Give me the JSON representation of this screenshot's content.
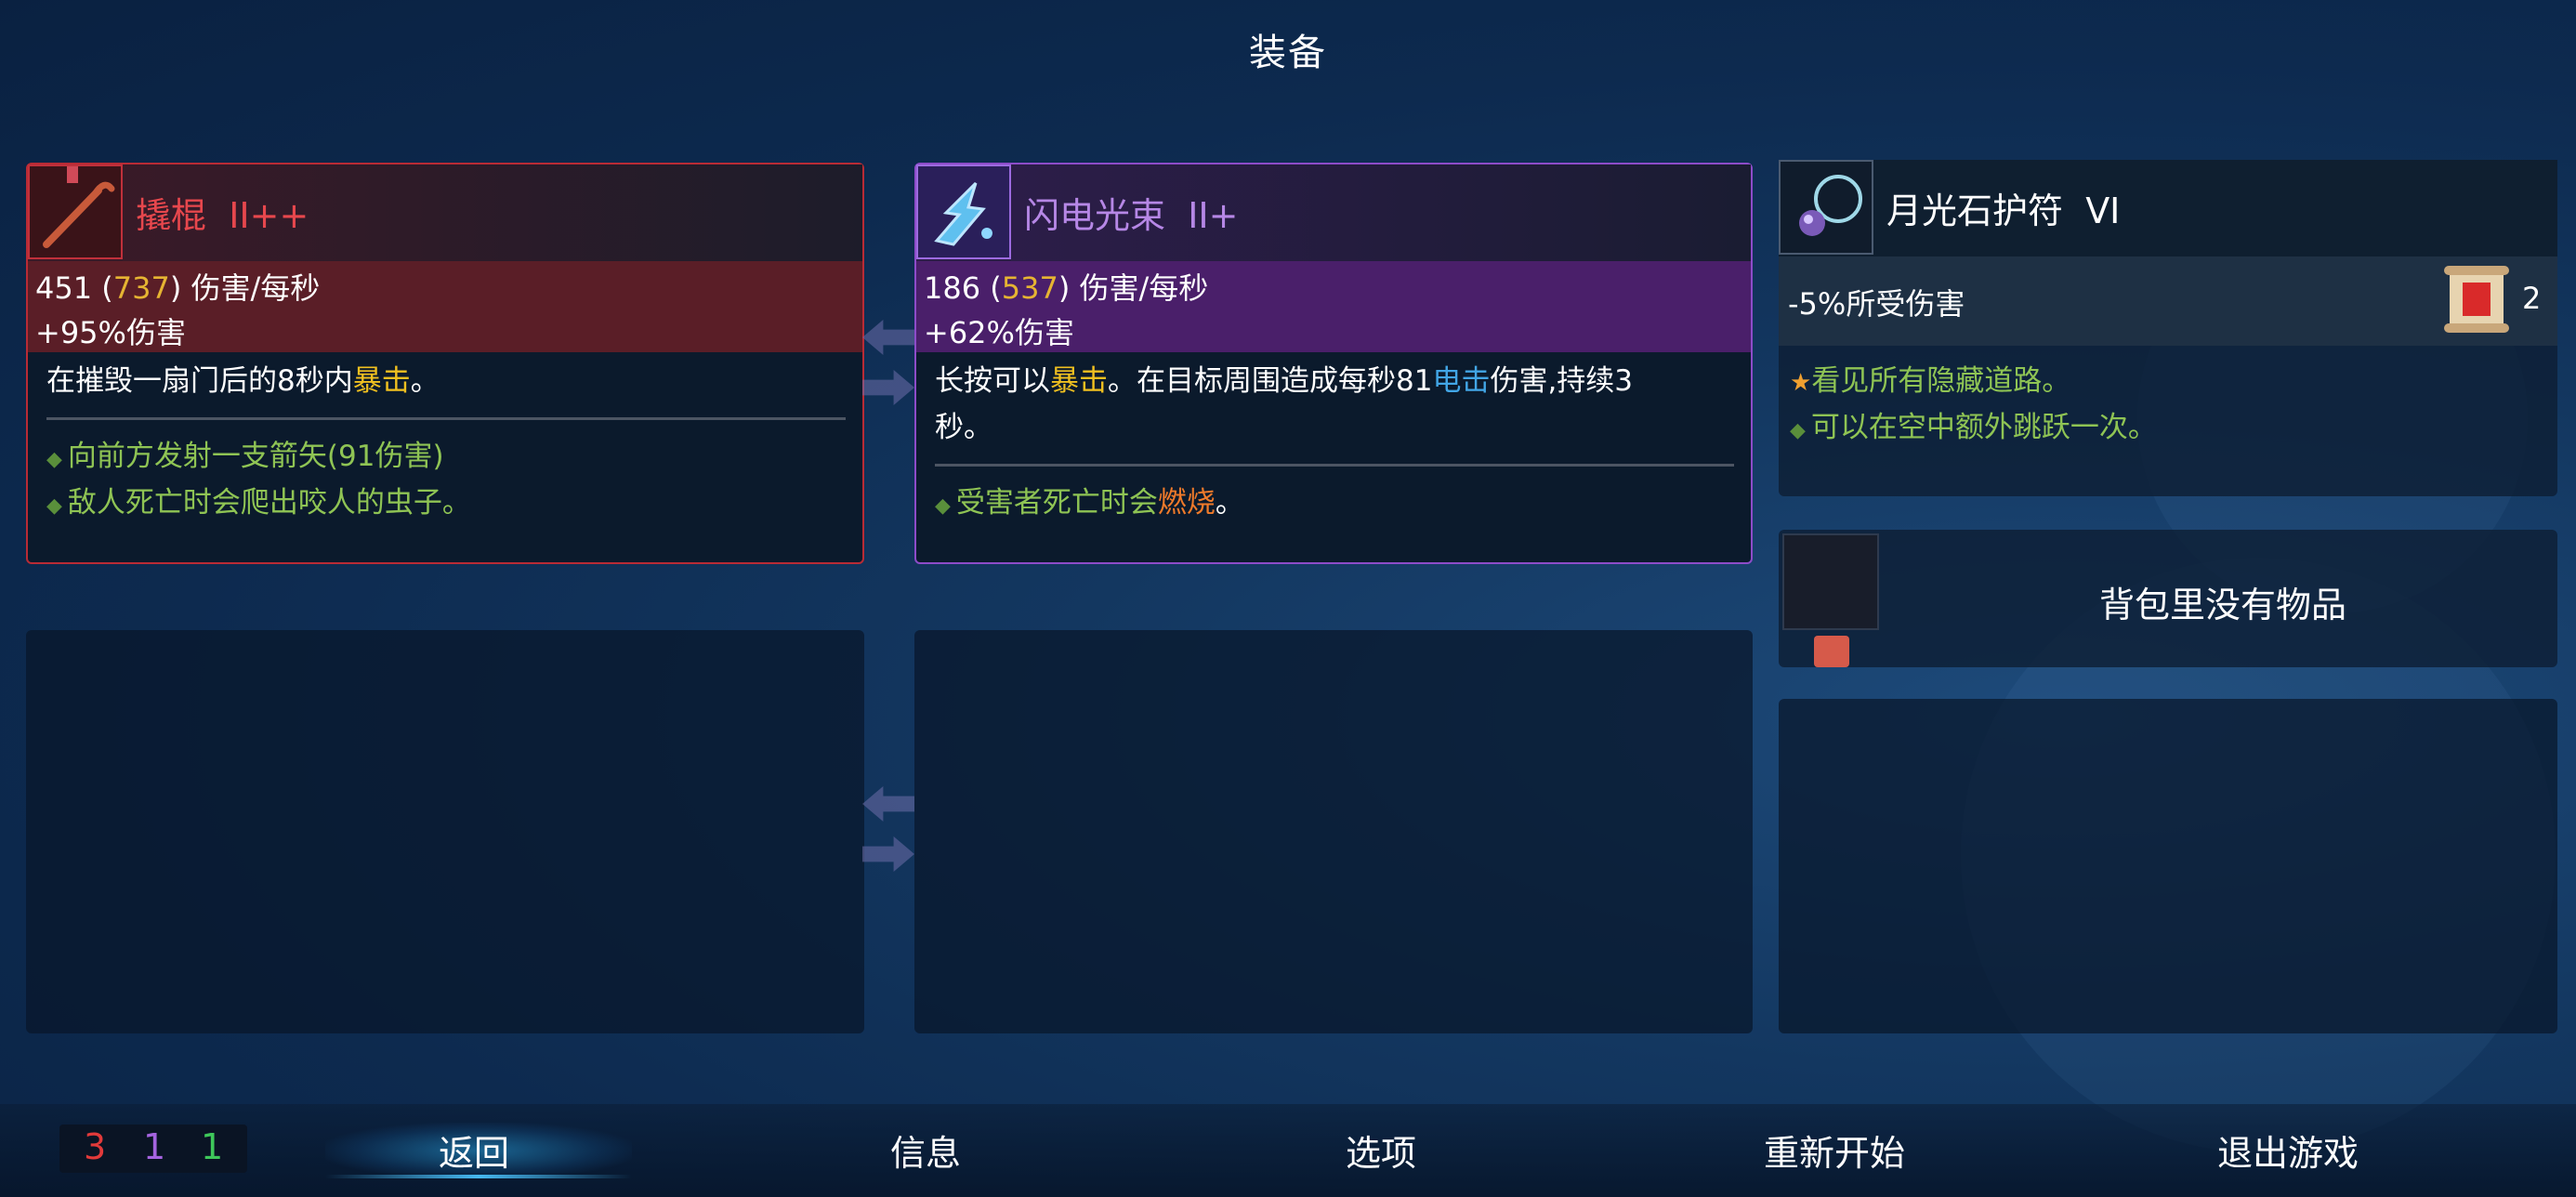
{
  "title": "装备",
  "weapon1": {
    "name": "撬棍",
    "tier": "II++",
    "dps": "451",
    "dps_bonus": "737",
    "dps_unit": "伤害/每秒",
    "bonus": "+95%伤害",
    "desc_pre": "在摧毁一扇门后的8秒内",
    "desc_crit": "暴击",
    "desc_post": "。",
    "affix1": "向前方发射一支箭矢(91伤害)",
    "affix2": "敌人死亡时会爬出咬人的虫子。"
  },
  "weapon2": {
    "name": "闪电光束",
    "tier": "II+",
    "dps": "186",
    "dps_bonus": "537",
    "dps_unit": "伤害/每秒",
    "bonus": "+62%伤害",
    "desc_a": "长按可以",
    "desc_crit": "暴击",
    "desc_b": "。在目标周围造成每秒81",
    "desc_elec": "电击",
    "desc_c": "伤害,持续3",
    "desc_d": "秒。",
    "affix_pre": "受害者死亡时会",
    "affix_burn": "燃烧",
    "affix_post": "。"
  },
  "amulet": {
    "name": "月光石护符",
    "tier": "VI",
    "stat": "-5%所受伤害",
    "scroll_count": "2",
    "perk1": "看见所有隐藏道路。",
    "perk2": "可以在空中额外跳跃一次。"
  },
  "backpack": {
    "empty_text": "背包里没有物品"
  },
  "counters": {
    "red": "3",
    "purple": "1",
    "green": "1",
    "red_color": "#e23a3a",
    "purple_color": "#a564e0",
    "green_color": "#3ec85a"
  },
  "menu": {
    "back": "返回",
    "info": "信息",
    "options": "选项",
    "restart": "重新开始",
    "quit": "退出游戏"
  }
}
